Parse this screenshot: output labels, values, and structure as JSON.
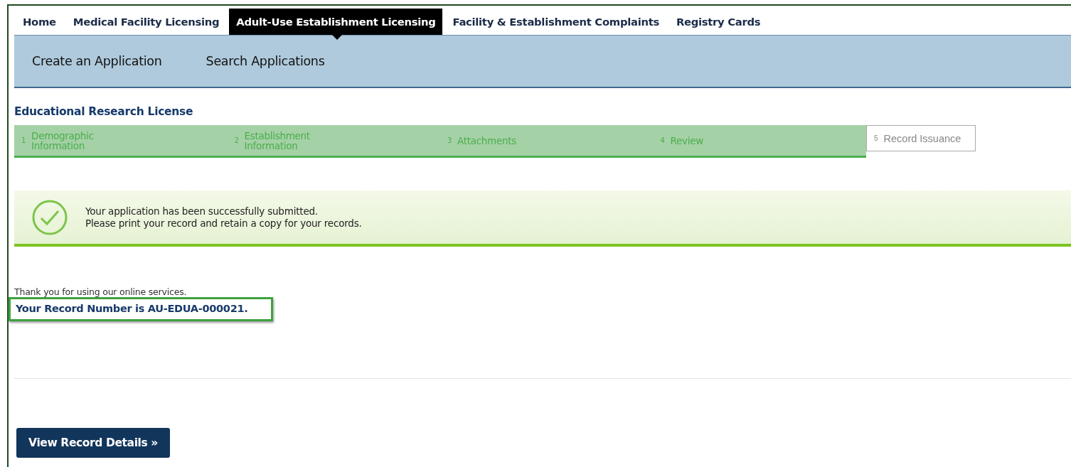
{
  "nav_tabs": [
    {
      "label": "Home",
      "selected": false
    },
    {
      "label": "Medical Facility Licensing",
      "selected": false
    },
    {
      "label": "Adult-Use Establishment Licensing",
      "selected": true
    },
    {
      "label": "Facility & Establishment Complaints",
      "selected": false
    },
    {
      "label": "Registry Cards",
      "selected": false
    }
  ],
  "sub_nav": [
    "Create an Application",
    "Search Applications"
  ],
  "page_title": "Educational Research License",
  "steps": [
    {
      "number": "1",
      "label": "Demographic Information",
      "selected": false
    },
    {
      "number": "2",
      "label": "Establishment Information",
      "selected": false
    },
    {
      "number": "3",
      "label": "Attachments",
      "selected": false
    },
    {
      "number": "4",
      "label": "Review",
      "selected": false
    },
    {
      "number": "5",
      "label": "Record Issuance",
      "selected": true
    }
  ],
  "success_message": [
    "Your application has been successfully submitted.",
    "Please print your record and retain a copy for your records."
  ],
  "thank_you": "Thank you for using our online services.",
  "record_number": "Your Record Number is AU-EDUA-000021.",
  "button": "View Record Details »"
}
